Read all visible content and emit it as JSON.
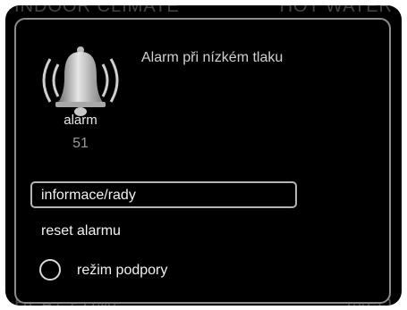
{
  "background": {
    "top_left": "INDOOR CLIMATE",
    "top_right": "HOT WATER",
    "bottom_left": "HEAT PUMP",
    "bottom_right": "INFO"
  },
  "alarm": {
    "icon": "bell-icon",
    "title": "Alarm při nízkém tlaku",
    "label": "alarm",
    "code": "51"
  },
  "menu": {
    "items": [
      {
        "label": "informace/rady",
        "selected": true
      },
      {
        "label": "reset alarmu"
      },
      {
        "label": "režim podpory",
        "control": "radio",
        "checked": false
      }
    ]
  },
  "colors": {
    "screen": "#000000",
    "frame": "#8c8c8c",
    "text": "#f2f2f2"
  }
}
